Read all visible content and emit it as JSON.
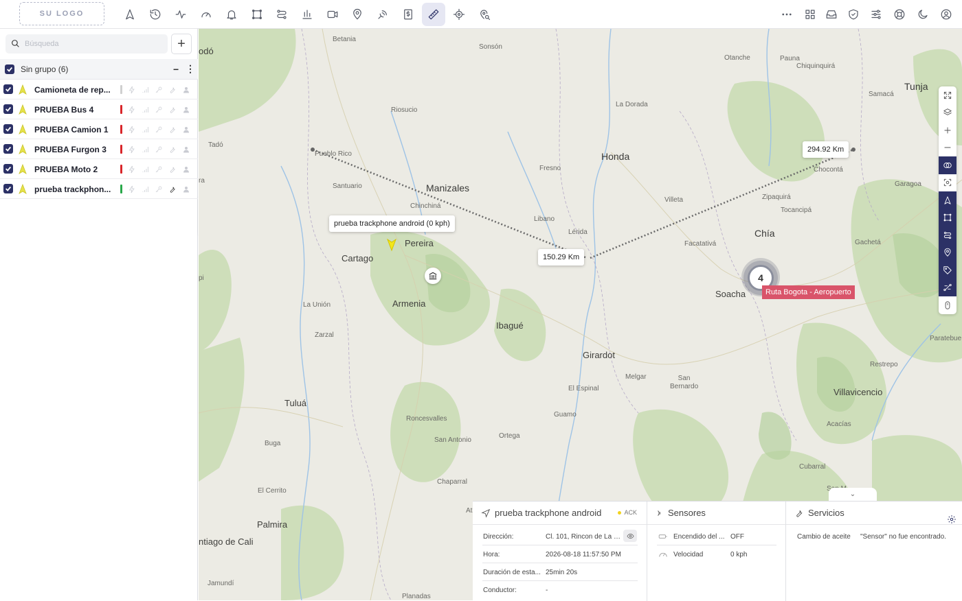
{
  "logo": "SU LOGO",
  "toolbar": {
    "left_icons": [
      "navigation-icon",
      "history-icon",
      "activity-icon",
      "gauge-icon",
      "bell-icon",
      "geofence-icon",
      "route-icon",
      "bar-chart-icon",
      "video-icon",
      "map-pin-icon",
      "satellite-icon",
      "dollar-document-icon",
      "ruler-icon",
      "target-icon",
      "location-search-icon"
    ],
    "active_icon": "ruler-icon",
    "right_icons": [
      "more-icon",
      "grid-icon",
      "inbox-icon",
      "shield-icon",
      "sliders-icon",
      "support-icon",
      "moon-icon",
      "user-icon"
    ]
  },
  "search": {
    "placeholder": "Búsqueda"
  },
  "group": {
    "label": "Sin grupo (6)"
  },
  "devices": [
    {
      "name": "Camioneta de rep...",
      "status_color": "#d0d0d0",
      "tool_dark": false
    },
    {
      "name": "PRUEBA Bus 4",
      "status_color": "#d9262a",
      "tool_dark": false
    },
    {
      "name": "PRUEBA Camion 1",
      "status_color": "#d9262a",
      "tool_dark": false
    },
    {
      "name": "PRUEBA Furgon 3",
      "status_color": "#d9262a",
      "tool_dark": false
    },
    {
      "name": "PRUEBA Moto 2",
      "status_color": "#d9262a",
      "tool_dark": false
    },
    {
      "name": "prueba trackphon...",
      "status_color": "#2aa84a",
      "tool_dark": true
    }
  ],
  "map": {
    "labels": {
      "betania": "Betania",
      "sonson": "Sonsón",
      "otanche": "Otanche",
      "pauna": "Pauna",
      "chiquinquira": "Chiquinquirá",
      "tunja": "Tunja",
      "samaca": "Samacá",
      "riosucio": "Riosucio",
      "la_dorada": "La Dorada",
      "tado": "Tadó",
      "pueblo_rico": "Pueblo Rico",
      "honda": "Honda",
      "fresno": "Fresno",
      "chocont": "Chocontá",
      "santuario": "Santuario",
      "manizales": "Manizales",
      "zipaquira": "Zipaquirá",
      "garagoa": "Garagoa",
      "chinchina": "Chinchiná",
      "villeta": "Villeta",
      "tocancipa": "Tocancipá",
      "libano": "Libano",
      "lerida": "Lérida",
      "chia": "Chía",
      "pereira": "Pereira",
      "cartago": "Cartago",
      "facatativa": "Facatativá",
      "gacheta": "Gachetá",
      "soacha": "Soacha",
      "la_union": "La Unión",
      "armenia": "Armenia",
      "ibague": "Ibagué",
      "zarzal": "Zarzal",
      "paratebue": "Paratebue",
      "girardot": "Girardot",
      "restrepo": "Restrepo",
      "melgar": "Melgar",
      "san_bernardo": "San\nBernardo",
      "el_espinal": "El Espinal",
      "villavicencio": "Villavicencio",
      "tulua": "Tuluá",
      "roncesvalles": "Roncesvalles",
      "guamo": "Guamo",
      "acacias": "Acacías",
      "san_antonio": "San Antonio",
      "ortega": "Ortega",
      "buga": "Buga",
      "cubarral": "Cubarral",
      "chaparral": "Chaparral",
      "el_cerrito": "El Cerrito",
      "palmira": "Palmira",
      "santiago_cali": "ntiago de Cali",
      "jamundi": "Jamundí",
      "planadas": "Planadas",
      "condo": "odó",
      "pi": "pi",
      "ra": "ra",
      "ata": "Ata",
      "san_m": "San M"
    },
    "measure_1": "150.29 Km",
    "measure_2": "294.92 Km",
    "device_tooltip": "prueba trackphone android (0 kph)",
    "cluster_count": "4",
    "route_label": "Ruta Bogota - Aeropuerto"
  },
  "map_controls": [
    "fullscreen-icon",
    "layers-icon",
    "zoom-in-icon",
    "zoom-out-icon",
    "overlap-icon",
    "focus-icon",
    "navigation-icon",
    "geofence-icon",
    "route-icon",
    "map-pin-icon",
    "tag-icon",
    "share-route-icon",
    "mouse-icon"
  ],
  "panel": {
    "device": {
      "title": "prueba trackphone android",
      "ack": "ACK",
      "fields": [
        {
          "k": "Dirección:",
          "v": "Cl. 101, Rincon de La P..."
        },
        {
          "k": "Hora:",
          "v": "2026-08-18 11:57:50 PM"
        },
        {
          "k": "Duración de esta...",
          "v": "25min 20s"
        },
        {
          "k": "Conductor:",
          "v": "-"
        }
      ]
    },
    "sensors": {
      "title": "Sensores",
      "items": [
        {
          "k": "Encendido del ...",
          "v": "OFF"
        },
        {
          "k": "Velocidad",
          "v": "0 kph"
        }
      ]
    },
    "services": {
      "title": "Servicios",
      "name": "Cambio de aceite",
      "value": "\"Sensor\" no fue encontrado."
    }
  }
}
